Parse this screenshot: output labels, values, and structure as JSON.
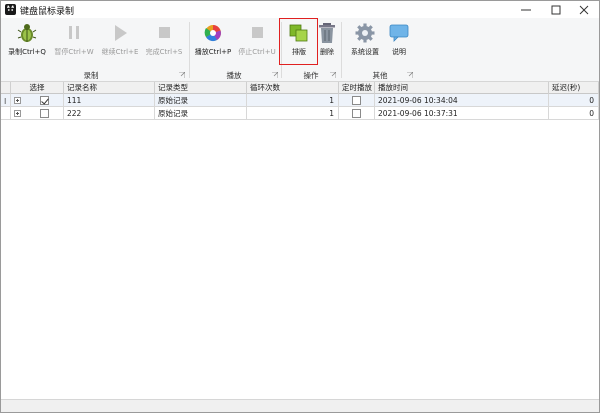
{
  "window": {
    "title": "键盘鼠标录制",
    "icon": "cat-icon"
  },
  "window_controls": [
    "minimize-icon",
    "maximize-icon",
    "close-icon"
  ],
  "ribbon": {
    "groups": [
      {
        "label": "录制"
      },
      {
        "label": "播放"
      },
      {
        "label": "操作"
      },
      {
        "label": "其他"
      }
    ],
    "buttons": {
      "record": {
        "label": "录制Ctrl+Q",
        "icon": "bug-record-icon",
        "enabled": true
      },
      "pause": {
        "label": "暂停Ctrl+W",
        "icon": "pause-icon",
        "enabled": false
      },
      "continue": {
        "label": "继续Ctrl+E",
        "icon": "play-icon",
        "enabled": false
      },
      "finish": {
        "label": "完成Ctrl+S",
        "icon": "stop-icon",
        "enabled": false
      },
      "play": {
        "label": "播放Ctrl+P",
        "icon": "color-wheel-icon",
        "enabled": true
      },
      "stop": {
        "label": "停止Ctrl+U",
        "icon": "stop-icon",
        "enabled": false
      },
      "arrange": {
        "label": "排版",
        "icon": "arrange-squares-icon",
        "enabled": true
      },
      "delete": {
        "label": "删除",
        "icon": "trash-icon",
        "enabled": true
      },
      "settings": {
        "label": "系统设置",
        "icon": "gear-icon",
        "enabled": true
      },
      "help": {
        "label": "说明",
        "icon": "speech-bubble-icon",
        "enabled": true
      }
    },
    "colors": {
      "highlight": "#e02020"
    }
  },
  "grid": {
    "columns": [
      "选择",
      "记录名称",
      "记录类型",
      "循环次数",
      "定时播放",
      "播放时间",
      "延迟(秒)"
    ],
    "rows": [
      {
        "selected_checkbox": true,
        "name": "111",
        "type": "原始记录",
        "loops": "1",
        "timed": false,
        "play_time": "2021-09-06 10:34:04",
        "delay": "0",
        "current": true
      },
      {
        "selected_checkbox": false,
        "name": "222",
        "type": "原始记录",
        "loops": "1",
        "timed": false,
        "play_time": "2021-09-06 10:37:31",
        "delay": "0",
        "current": false
      }
    ],
    "row_indicator": "I"
  }
}
